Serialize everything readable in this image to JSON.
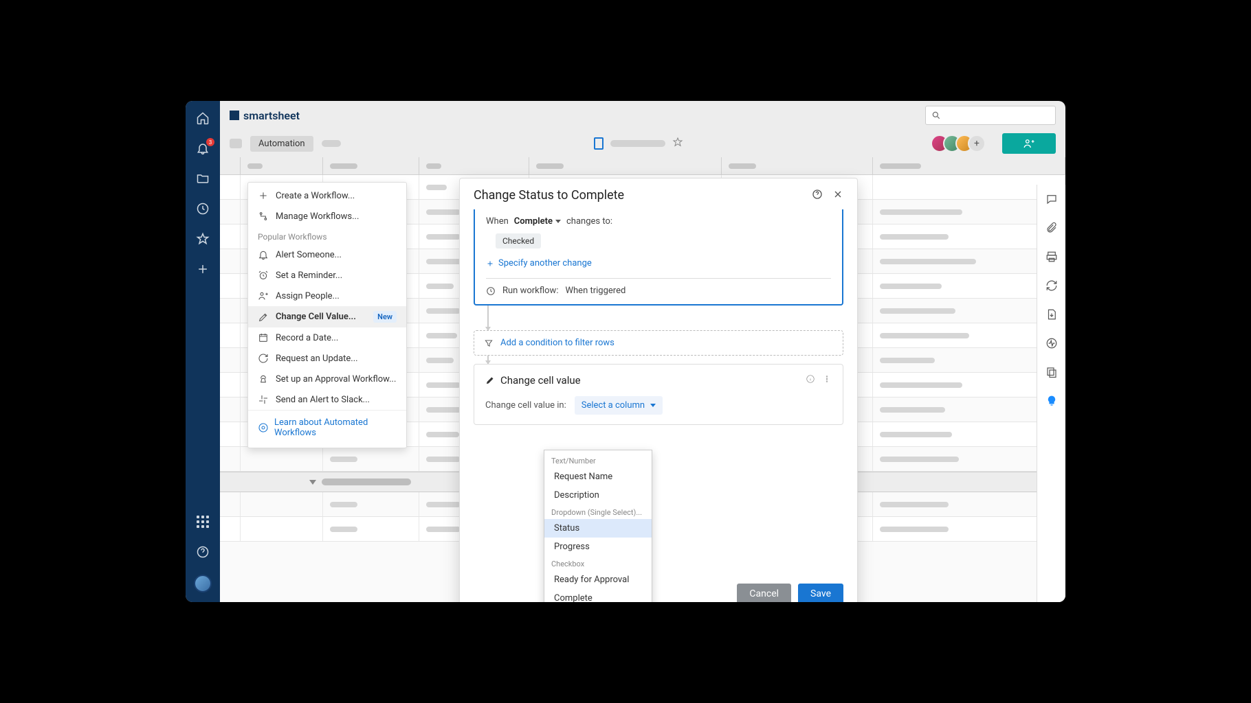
{
  "brand": "smartsheet",
  "notification_count": "3",
  "toolbar": {
    "automation": "Automation"
  },
  "auto_menu": {
    "create": "Create a Workflow...",
    "manage": "Manage Workflows...",
    "popular_header": "Popular Workflows",
    "alert": "Alert Someone...",
    "reminder": "Set a Reminder...",
    "assign": "Assign People...",
    "change_cell": "Change Cell Value...",
    "new_tag": "New",
    "record_date": "Record a Date...",
    "request_update": "Request an Update...",
    "approval": "Set up an Approval Workflow...",
    "slack": "Send an Alert to Slack...",
    "learn": "Learn about Automated Workflows"
  },
  "modal": {
    "title": "Change Status to Complete",
    "trigger_when": "When",
    "trigger_field": "Complete",
    "trigger_changes_to": "changes to:",
    "chip_checked": "Checked",
    "specify": "Specify another change",
    "run_label": "Run workflow:",
    "run_value": "When triggered",
    "condition": "Add a condition to filter rows",
    "action_title": "Change cell value",
    "action_label": "Change cell value in:",
    "select_column": "Select a column",
    "cancel": "Cancel",
    "save": "Save"
  },
  "dropdown": {
    "sect1": "Text/Number",
    "opt1": "Request Name",
    "opt2": "Description",
    "sect2": "Dropdown (Single Select)...",
    "opt3": "Status",
    "opt4": "Progress",
    "sect3": "Checkbox",
    "opt5": "Ready for Approval",
    "opt6": "Complete"
  }
}
